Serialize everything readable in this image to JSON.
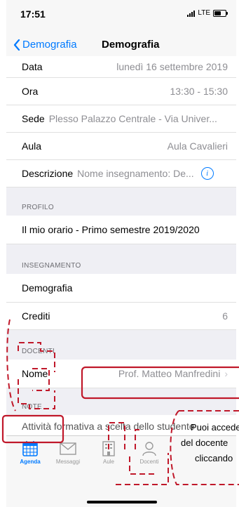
{
  "status": {
    "time": "17:51",
    "network": "LTE"
  },
  "nav": {
    "back_label": "Demografia",
    "title": "Demografia"
  },
  "details": [
    {
      "label": "Data",
      "value": "lunedì 16 settembre 2019"
    },
    {
      "label": "Ora",
      "value": "13:30 - 15:30"
    },
    {
      "label": "Sede",
      "value": "Plesso Palazzo Centrale - Via Univer..."
    },
    {
      "label": "Aula",
      "value": "Aula Cavalieri"
    },
    {
      "label": "Descrizione",
      "value": "Nome insegnamento: De..."
    }
  ],
  "profilo": {
    "header": "PROFILO",
    "item": "Il mio orario - Primo semestre 2019/2020"
  },
  "insegnamento": {
    "header": "INSEGNAMENTO",
    "name": "Demografia",
    "crediti_label": "Crediti",
    "crediti_value": "6"
  },
  "docenti": {
    "header": "DOCENTI",
    "nome_label": "Nome",
    "nome_value": "Prof. Matteo Manfredini"
  },
  "note": {
    "header": "NOTE",
    "text": "Attività formativa a scelta dello studente"
  },
  "tabs": [
    {
      "label": "Agenda",
      "icon": "calendar-icon",
      "active": true
    },
    {
      "label": "Messaggi",
      "icon": "envelope-icon",
      "active": false
    },
    {
      "label": "Aule",
      "icon": "building-icon",
      "active": false
    },
    {
      "label": "Docenti",
      "icon": "person-icon",
      "active": false
    }
  ],
  "callout": {
    "line1": "Puoi accedere",
    "line2": "del docente",
    "line3": "cliccando"
  },
  "colors": {
    "accent": "#007aff",
    "annotation": "#c0182a"
  }
}
